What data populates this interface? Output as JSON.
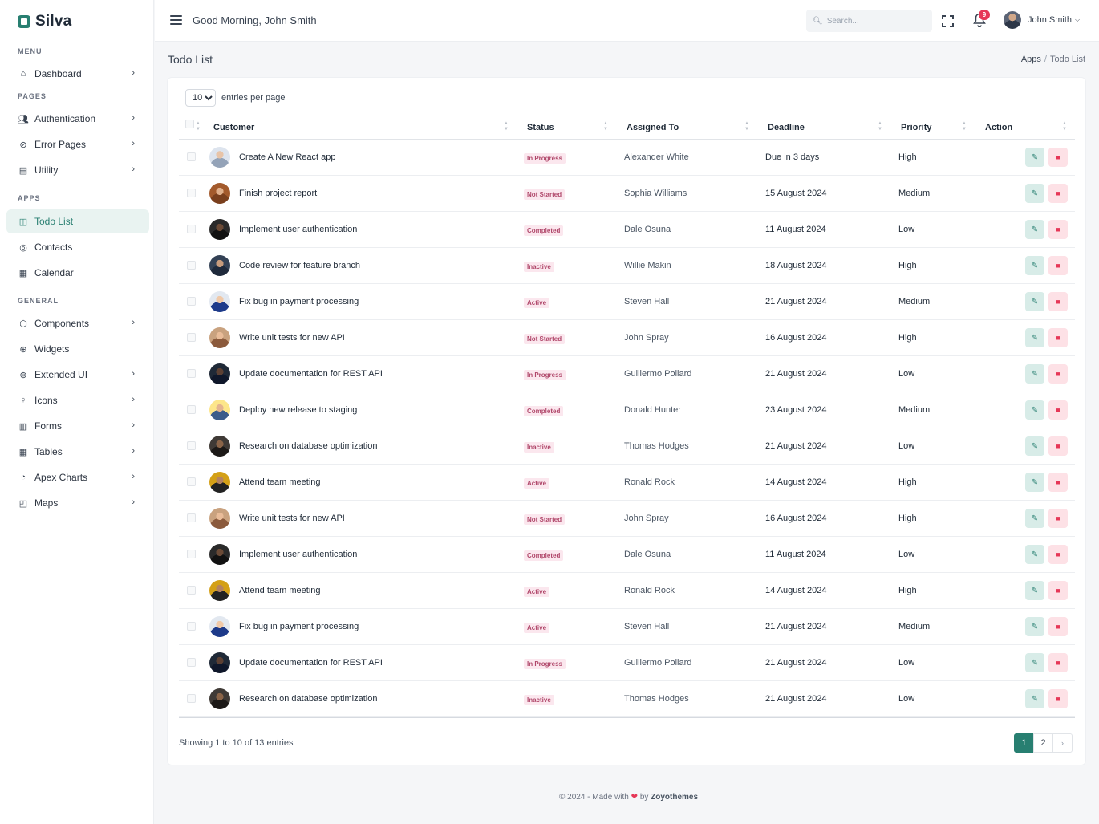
{
  "app": {
    "logo": "Silva"
  },
  "sidebar": {
    "sections": {
      "menu": "MENU",
      "pages": "PAGES",
      "apps": "APPS",
      "general": "GENERAL"
    },
    "items": [
      {
        "label": "Dashboard",
        "icon": "home-icon",
        "chevron": true
      },
      {
        "label": "Authentication",
        "icon": "users-icon",
        "chevron": true
      },
      {
        "label": "Error Pages",
        "icon": "alert-circle-icon",
        "chevron": true
      },
      {
        "label": "Utility",
        "icon": "file-icon",
        "chevron": true
      },
      {
        "label": "Todo List",
        "icon": "columns-icon",
        "chevron": false,
        "active": true
      },
      {
        "label": "Contacts",
        "icon": "map-pin-icon",
        "chevron": false
      },
      {
        "label": "Calendar",
        "icon": "calendar-icon",
        "chevron": false
      },
      {
        "label": "Components",
        "icon": "box-icon",
        "chevron": true
      },
      {
        "label": "Widgets",
        "icon": "globe-icon",
        "chevron": false
      },
      {
        "label": "Extended UI",
        "icon": "layers-icon",
        "chevron": true
      },
      {
        "label": "Icons",
        "icon": "award-icon",
        "chevron": true
      },
      {
        "label": "Forms",
        "icon": "briefcase-icon",
        "chevron": true
      },
      {
        "label": "Tables",
        "icon": "table-icon",
        "chevron": true
      },
      {
        "label": "Apex Charts",
        "icon": "pie-chart-icon",
        "chevron": true
      },
      {
        "label": "Maps",
        "icon": "map-icon",
        "chevron": true
      }
    ]
  },
  "topbar": {
    "greeting": "Good Morning, John Smith",
    "search_placeholder": "Search...",
    "notification_count": "9",
    "user_name": "John Smith"
  },
  "page": {
    "title": "Todo List",
    "breadcrumb": [
      "Apps",
      "Todo List"
    ]
  },
  "table": {
    "entries_value": "10",
    "entries_label": "entries per page",
    "columns": [
      "Customer",
      "Status",
      "Assigned To",
      "Deadline",
      "Priority",
      "Action"
    ],
    "rows": [
      {
        "task": "Create A New React app",
        "status": "In Progress",
        "assigned": "Alexander White",
        "deadline": "Due in 3 days",
        "priority": "High"
      },
      {
        "task": "Finish project report",
        "status": "Not Started",
        "assigned": "Sophia Williams",
        "deadline": "15 August 2024",
        "priority": "Medium"
      },
      {
        "task": "Implement user authentication",
        "status": "Completed",
        "assigned": "Dale Osuna",
        "deadline": "11 August 2024",
        "priority": "Low"
      },
      {
        "task": "Code review for feature branch",
        "status": "Inactive",
        "assigned": "Willie Makin",
        "deadline": "18 August 2024",
        "priority": "High"
      },
      {
        "task": "Fix bug in payment processing",
        "status": "Active",
        "assigned": "Steven Hall",
        "deadline": "21 August 2024",
        "priority": "Medium"
      },
      {
        "task": "Write unit tests for new API",
        "status": "Not Started",
        "assigned": "John Spray",
        "deadline": "16 August 2024",
        "priority": "High"
      },
      {
        "task": "Update documentation for REST API",
        "status": "In Progress",
        "assigned": "Guillermo Pollard",
        "deadline": "21 August 2024",
        "priority": "Low"
      },
      {
        "task": "Deploy new release to staging",
        "status": "Completed",
        "assigned": "Donald Hunter",
        "deadline": "23 August 2024",
        "priority": "Medium"
      },
      {
        "task": "Research on database optimization",
        "status": "Inactive",
        "assigned": "Thomas Hodges",
        "deadline": "21 August 2024",
        "priority": "Low"
      },
      {
        "task": "Attend team meeting",
        "status": "Active",
        "assigned": "Ronald Rock",
        "deadline": "14 August 2024",
        "priority": "High"
      },
      {
        "task": "Write unit tests for new API",
        "status": "Not Started",
        "assigned": "John Spray",
        "deadline": "16 August 2024",
        "priority": "High"
      },
      {
        "task": "Implement user authentication",
        "status": "Completed",
        "assigned": "Dale Osuna",
        "deadline": "11 August 2024",
        "priority": "Low"
      },
      {
        "task": "Attend team meeting",
        "status": "Active",
        "assigned": "Ronald Rock",
        "deadline": "14 August 2024",
        "priority": "High"
      },
      {
        "task": "Fix bug in payment processing",
        "status": "Active",
        "assigned": "Steven Hall",
        "deadline": "21 August 2024",
        "priority": "Medium"
      },
      {
        "task": "Update documentation for REST API",
        "status": "In Progress",
        "assigned": "Guillermo Pollard",
        "deadline": "21 August 2024",
        "priority": "Low"
      },
      {
        "task": "Research on database optimization",
        "status": "Inactive",
        "assigned": "Thomas Hodges",
        "deadline": "21 August 2024",
        "priority": "Low"
      }
    ],
    "showing": "Showing 1 to 10 of 13 entries",
    "pages": [
      "1",
      "2"
    ],
    "next_label": "›"
  },
  "footer": {
    "prefix": "© 2024 - Made with",
    "heart": "❤",
    "by": "by",
    "brand": "Zoyothemes"
  },
  "colors": {
    "accent": "#287f71",
    "danger": "#e63757",
    "status_badge_bg": "#fbe7ee"
  }
}
